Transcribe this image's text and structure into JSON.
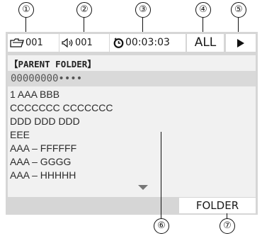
{
  "callouts": [
    "①",
    "②",
    "③",
    "④",
    "⑤",
    "⑥",
    "⑦"
  ],
  "status_bar": {
    "folder_number": "001",
    "track_number": "001",
    "elapsed_time": "00:03:03",
    "repeat_mode": "ALL",
    "play_state": "▶"
  },
  "icons": {
    "folder": "folder-icon",
    "speaker": "speaker-icon",
    "clock": "clock-icon",
    "play": "play-icon",
    "scroll_down": "scroll-down-arrow-icon"
  },
  "panel": {
    "parent_folder": "【PARENT FOLDER】",
    "current_folder": "00000000••••",
    "items": [
      "1  AAA  BBB",
      "CCCCCCC  CCCCCCC",
      "DDD DDD DDD",
      "EEE",
      "AAA  – FFFFFF",
      "AAA  – GGGG",
      "AAA  – HHHHH"
    ]
  },
  "buttons": {
    "folder": "FOLDER"
  }
}
